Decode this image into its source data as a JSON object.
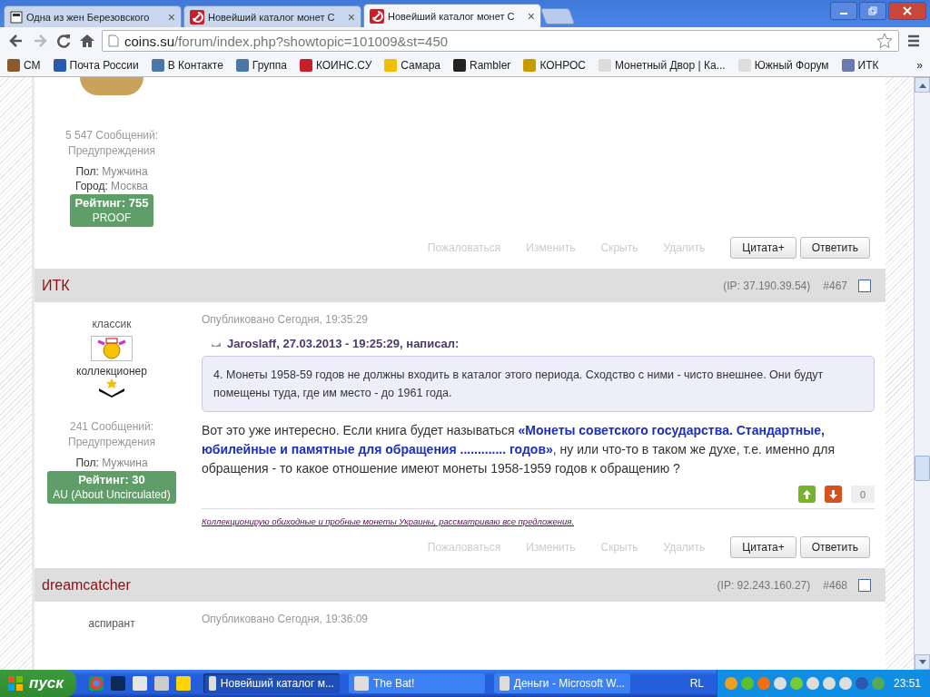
{
  "browser": {
    "tabs": [
      {
        "title": "Одна из жен Березовского",
        "selected": false
      },
      {
        "title": "Новейший каталог монет С",
        "selected": false
      },
      {
        "title": "Новейший каталог монет С",
        "selected": true
      }
    ],
    "close_glyph": "×",
    "url": {
      "host": "coins.su",
      "path": "/forum/index.php?showtopic=101009&st=450"
    },
    "bookmarks": [
      "СМ",
      "Почта России",
      "В Контакте",
      "Группа",
      "КОИНС.СУ",
      "Самара",
      "Rambler",
      "КОНРОС",
      "Монетный Двор | Ка...",
      "Южный Форум",
      "ИТК"
    ],
    "bookmarks_overflow": "»"
  },
  "posts": [
    {
      "author": {
        "posts_count": "5 547 Сообщений:",
        "warnings": "Предупреждения",
        "fields": [
          {
            "label": "Пол:",
            "value": "Мужчина"
          },
          {
            "label": "Город:",
            "value": "Москва"
          }
        ],
        "rating": "Рейтинг: 755",
        "grade": "PROOF"
      },
      "actions": [
        "Пожаловаться",
        "Изменить",
        "Скрыть",
        "Удалить"
      ],
      "buttons": [
        "Цитата+",
        "Ответить"
      ]
    },
    {
      "header": {
        "name": "ИТК",
        "ip": "(IP: 37.190.39.54)",
        "number": "#467",
        "checked": false
      },
      "author": {
        "group": "классик",
        "title": "коллекционер",
        "posts_count": "241 Сообщений:",
        "warnings": "Предупреждения",
        "fields": [
          {
            "label": "Пол:",
            "value": "Мужчина"
          }
        ],
        "rating": "Рейтинг: 30",
        "grade": "AU (About Uncirculated)"
      },
      "published": "Опубликовано Сегодня, 19:35:29",
      "quote": {
        "cite": "Jaroslaff, 27.03.2013 - 19:25:29, написал:",
        "text": "4. Монеты 1958-59 годов не должны входить в каталог этого периода. Сходство с ними - чисто внешнее. Они будут помещены туда, где им место - до 1961 года."
      },
      "body": "Вот это уже интересно. Если книга будет называться **«Монеты советского государства. Стандартные, юбилейные и памятные для обращения ............. годов»**, ну или что-то в таком же духе, т.е. именно для обращения - то какое отношение имеют монеты 1958-1959 годов к обращению ?",
      "score": "0",
      "signature": "Коллекционирую обиходные и пробные монеты Украины, рассматриваю все предложения.",
      "actions": [
        "Пожаловаться",
        "Изменить",
        "Скрыть",
        "Удалить"
      ],
      "buttons": [
        "Цитата+",
        "Ответить"
      ]
    },
    {
      "header": {
        "name": "dreamcatcher",
        "ip": "(IP: 92.243.160.27)",
        "number": "#468",
        "checked": false
      },
      "author": {
        "group": "аспирант"
      },
      "published": "Опубликовано Сегодня, 19:36:09"
    }
  ],
  "taskbar": {
    "start": "пуск",
    "tasks": [
      {
        "title": "Новейший каталог м...",
        "selected": true
      },
      {
        "title": "The Bat!",
        "selected": false
      },
      {
        "title": "Деньги - Microsoft W...",
        "selected": false
      }
    ],
    "language": "RL",
    "time": "23:51"
  }
}
